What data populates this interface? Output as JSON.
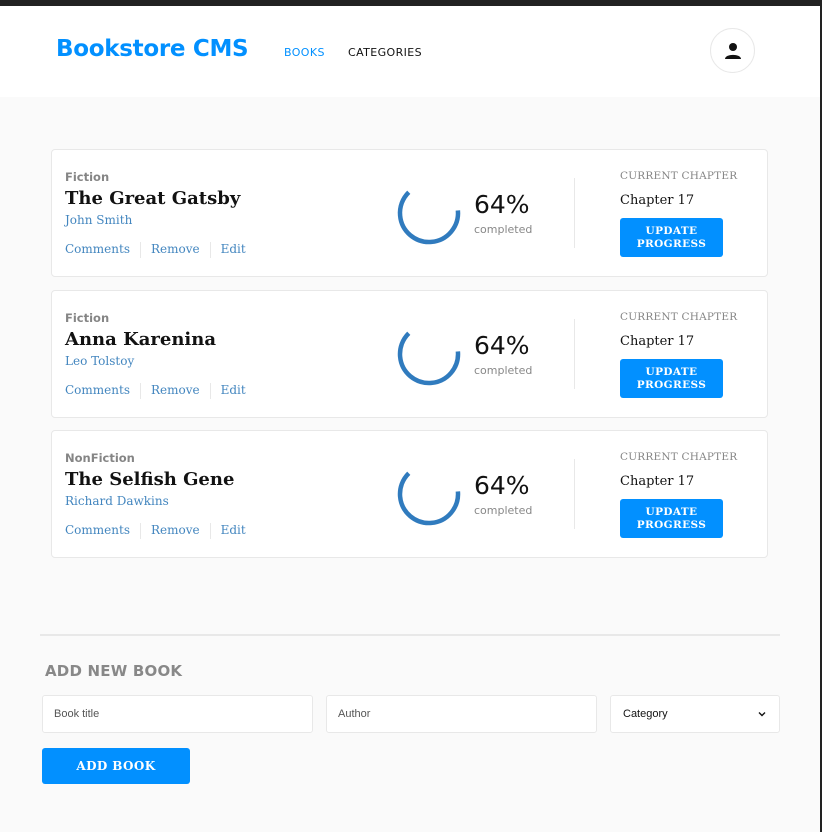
{
  "header": {
    "brand": "Bookstore CMS",
    "nav": [
      {
        "label": "BOOKS",
        "active": true
      },
      {
        "label": "CATEGORIES",
        "active": false
      }
    ],
    "avatar_icon": "user-icon"
  },
  "books": [
    {
      "category": "Fiction",
      "title": "The Great Gatsby",
      "author": "John Smith",
      "actions": [
        "Comments",
        "Remove",
        "Edit"
      ],
      "progress": 0.64,
      "percent_label": "64%",
      "completed_label": "completed",
      "chapter_label": "CURRENT CHAPTER",
      "chapter": "Chapter 17",
      "update_label": "UPDATE PROGRESS"
    },
    {
      "category": "Fiction",
      "title": "Anna Karenina",
      "author": "Leo Tolstoy",
      "actions": [
        "Comments",
        "Remove",
        "Edit"
      ],
      "progress": 0.64,
      "percent_label": "64%",
      "completed_label": "completed",
      "chapter_label": "CURRENT CHAPTER",
      "chapter": "Chapter 17",
      "update_label": "UPDATE PROGRESS"
    },
    {
      "category": "NonFiction",
      "title": "The Selfish Gene",
      "author": "Richard Dawkins",
      "actions": [
        "Comments",
        "Remove",
        "Edit"
      ],
      "progress": 0.64,
      "percent_label": "64%",
      "completed_label": "completed",
      "chapter_label": "CURRENT CHAPTER",
      "chapter": "Chapter 17",
      "update_label": "UPDATE PROGRESS"
    }
  ],
  "form": {
    "heading": "ADD NEW BOOK",
    "title_placeholder": "Book title",
    "author_placeholder": "Author",
    "category_selected": "Category",
    "submit_label": "ADD BOOK"
  },
  "colors": {
    "primary": "#0290ff",
    "link": "#4386bf",
    "progress": "#307bbe",
    "background": "#fafafa"
  }
}
